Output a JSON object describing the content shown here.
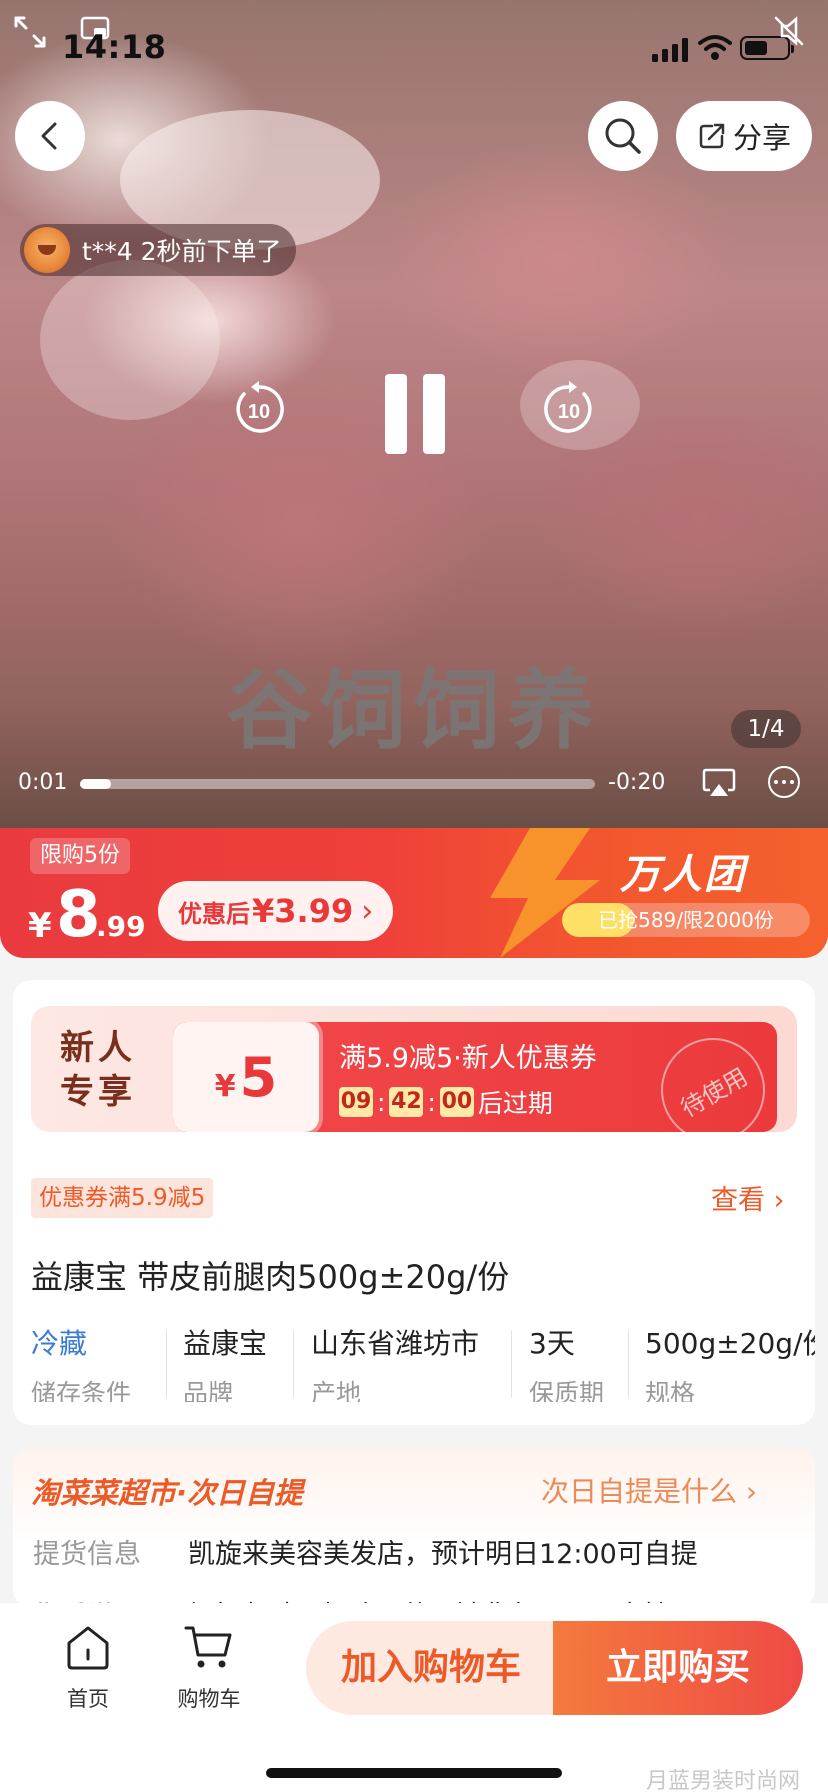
{
  "status_bar": {
    "time": "14:18"
  },
  "header": {
    "share_label": "分享"
  },
  "order_toast": {
    "text": "t**4 2秒前下单了"
  },
  "player": {
    "rewind_seconds": "10",
    "forward_seconds": "10",
    "caption": "谷饲饲养",
    "page_counter": "1/4",
    "elapsed": "0:01",
    "remaining": "-0:20",
    "progress": 0.06
  },
  "price_banner": {
    "limit_tag": "限购5份",
    "currency": "¥",
    "price_int": "8",
    "price_dec": ".99",
    "discount_label": "优惠后",
    "discount_value": "¥3.99",
    "group_title": "万人团",
    "grab_text": "已抢589/限2000份",
    "grab_progress": 0.29
  },
  "new_user": {
    "label": "新人专享",
    "coupon_currency": "¥",
    "coupon_amount": "5",
    "coupon_title": "满5.9减5·新人优惠券",
    "timer": [
      "09",
      "42",
      "00"
    ],
    "timer_suffix": "后过期",
    "stamp": "待使用"
  },
  "coupon_tag": "优惠券满5.9减5",
  "view_link": "查看",
  "product_title": "益康宝 带皮前腿肉500g±20g/份",
  "attributes": [
    {
      "value": "冷藏",
      "key": "储存条件",
      "highlight": true
    },
    {
      "value": "益康宝",
      "key": "品牌",
      "highlight": false
    },
    {
      "value": "山东省潍坊市",
      "key": "产地",
      "highlight": false
    },
    {
      "value": "3天",
      "key": "保质期",
      "highlight": false
    },
    {
      "value": "500g±20g/份",
      "key": "规格",
      "highlight": false
    }
  ],
  "pickup": {
    "brand": "淘菜菜超市·次日自提",
    "help": "次日自提是什么",
    "pickup_label": "提货信息",
    "pickup_value": "凯旋来美容美发店，预计明日12:00可自提",
    "aftersale_label": "售后说明",
    "aftersale_value": "坏损包赔 · 极速退款 · 缺货包退 · 不支持…"
  },
  "bottom_nav": {
    "home_label": "首页",
    "cart_label": "购物车",
    "add_cart": "加入购物车",
    "buy_now": "立即购买"
  },
  "watermark": "月蓝男装时尚网",
  "colors": {
    "accent": "#ef3f3a",
    "orange": "#ec5a28",
    "blue": "#3a7bd5"
  }
}
